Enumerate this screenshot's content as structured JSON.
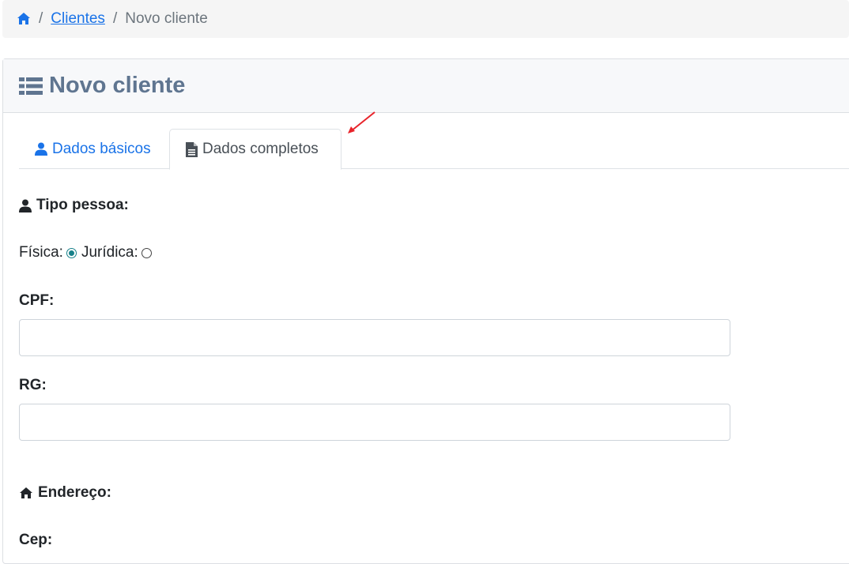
{
  "breadcrumb": {
    "home_icon": "home-icon",
    "items": [
      {
        "label": "Clientes",
        "link": true
      },
      {
        "label": "Novo cliente",
        "link": false
      }
    ],
    "separator": "/"
  },
  "page": {
    "title": "Novo cliente",
    "title_icon": "list-icon"
  },
  "tabs": [
    {
      "label": "Dados básicos",
      "icon": "user-icon",
      "active": false
    },
    {
      "label": "Dados completos",
      "icon": "file-text-icon",
      "active": true
    }
  ],
  "form": {
    "tipo_pessoa": {
      "label": "Tipo pessoa:",
      "options": [
        {
          "label": "Física:",
          "checked": true
        },
        {
          "label": "Jurídica:",
          "checked": false
        }
      ]
    },
    "cpf": {
      "label": "CPF:",
      "value": ""
    },
    "rg": {
      "label": "RG:",
      "value": ""
    },
    "endereco": {
      "label": "Endereço:"
    },
    "cep": {
      "label": "Cep:"
    }
  },
  "colors": {
    "accent": "#1a73e8",
    "title": "#5f7590",
    "radio_checked": "#17818a",
    "annotation_arrow": "#e8232a"
  }
}
